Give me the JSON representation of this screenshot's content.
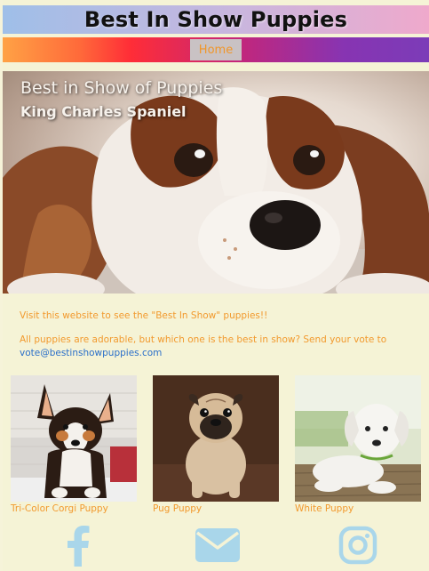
{
  "header": {
    "title": "Best In Show Puppies"
  },
  "nav": {
    "home_label": "Home"
  },
  "hero": {
    "title": "Best in Show of Puppies",
    "subtitle": "King Charles Spaniel"
  },
  "intro": {
    "line1": "Visit this website to see the \"Best In Show\" puppies!!",
    "line2": "All puppies are adorable, but which one is the best in show? Send your vote to",
    "email": "vote@bestinshowpuppies.com"
  },
  "gallery": [
    {
      "caption": "Tri-Color Corgi Puppy"
    },
    {
      "caption": "Pug Puppy"
    },
    {
      "caption": "White Puppy"
    }
  ],
  "social": {
    "color": "#a9d6ea",
    "icons": [
      "facebook-icon",
      "envelope-icon",
      "instagram-icon"
    ]
  }
}
